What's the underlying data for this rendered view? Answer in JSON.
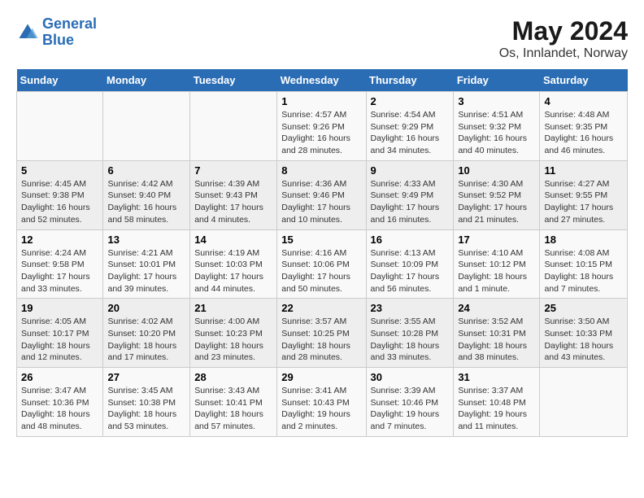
{
  "header": {
    "logo_line1": "General",
    "logo_line2": "Blue",
    "title": "May 2024",
    "subtitle": "Os, Innlandet, Norway"
  },
  "weekdays": [
    "Sunday",
    "Monday",
    "Tuesday",
    "Wednesday",
    "Thursday",
    "Friday",
    "Saturday"
  ],
  "weeks": [
    [
      {
        "day": "",
        "info": ""
      },
      {
        "day": "",
        "info": ""
      },
      {
        "day": "",
        "info": ""
      },
      {
        "day": "1",
        "info": "Sunrise: 4:57 AM\nSunset: 9:26 PM\nDaylight: 16 hours\nand 28 minutes."
      },
      {
        "day": "2",
        "info": "Sunrise: 4:54 AM\nSunset: 9:29 PM\nDaylight: 16 hours\nand 34 minutes."
      },
      {
        "day": "3",
        "info": "Sunrise: 4:51 AM\nSunset: 9:32 PM\nDaylight: 16 hours\nand 40 minutes."
      },
      {
        "day": "4",
        "info": "Sunrise: 4:48 AM\nSunset: 9:35 PM\nDaylight: 16 hours\nand 46 minutes."
      }
    ],
    [
      {
        "day": "5",
        "info": "Sunrise: 4:45 AM\nSunset: 9:38 PM\nDaylight: 16 hours\nand 52 minutes."
      },
      {
        "day": "6",
        "info": "Sunrise: 4:42 AM\nSunset: 9:40 PM\nDaylight: 16 hours\nand 58 minutes."
      },
      {
        "day": "7",
        "info": "Sunrise: 4:39 AM\nSunset: 9:43 PM\nDaylight: 17 hours\nand 4 minutes."
      },
      {
        "day": "8",
        "info": "Sunrise: 4:36 AM\nSunset: 9:46 PM\nDaylight: 17 hours\nand 10 minutes."
      },
      {
        "day": "9",
        "info": "Sunrise: 4:33 AM\nSunset: 9:49 PM\nDaylight: 17 hours\nand 16 minutes."
      },
      {
        "day": "10",
        "info": "Sunrise: 4:30 AM\nSunset: 9:52 PM\nDaylight: 17 hours\nand 21 minutes."
      },
      {
        "day": "11",
        "info": "Sunrise: 4:27 AM\nSunset: 9:55 PM\nDaylight: 17 hours\nand 27 minutes."
      }
    ],
    [
      {
        "day": "12",
        "info": "Sunrise: 4:24 AM\nSunset: 9:58 PM\nDaylight: 17 hours\nand 33 minutes."
      },
      {
        "day": "13",
        "info": "Sunrise: 4:21 AM\nSunset: 10:01 PM\nDaylight: 17 hours\nand 39 minutes."
      },
      {
        "day": "14",
        "info": "Sunrise: 4:19 AM\nSunset: 10:03 PM\nDaylight: 17 hours\nand 44 minutes."
      },
      {
        "day": "15",
        "info": "Sunrise: 4:16 AM\nSunset: 10:06 PM\nDaylight: 17 hours\nand 50 minutes."
      },
      {
        "day": "16",
        "info": "Sunrise: 4:13 AM\nSunset: 10:09 PM\nDaylight: 17 hours\nand 56 minutes."
      },
      {
        "day": "17",
        "info": "Sunrise: 4:10 AM\nSunset: 10:12 PM\nDaylight: 18 hours\nand 1 minute."
      },
      {
        "day": "18",
        "info": "Sunrise: 4:08 AM\nSunset: 10:15 PM\nDaylight: 18 hours\nand 7 minutes."
      }
    ],
    [
      {
        "day": "19",
        "info": "Sunrise: 4:05 AM\nSunset: 10:17 PM\nDaylight: 18 hours\nand 12 minutes."
      },
      {
        "day": "20",
        "info": "Sunrise: 4:02 AM\nSunset: 10:20 PM\nDaylight: 18 hours\nand 17 minutes."
      },
      {
        "day": "21",
        "info": "Sunrise: 4:00 AM\nSunset: 10:23 PM\nDaylight: 18 hours\nand 23 minutes."
      },
      {
        "day": "22",
        "info": "Sunrise: 3:57 AM\nSunset: 10:25 PM\nDaylight: 18 hours\nand 28 minutes."
      },
      {
        "day": "23",
        "info": "Sunrise: 3:55 AM\nSunset: 10:28 PM\nDaylight: 18 hours\nand 33 minutes."
      },
      {
        "day": "24",
        "info": "Sunrise: 3:52 AM\nSunset: 10:31 PM\nDaylight: 18 hours\nand 38 minutes."
      },
      {
        "day": "25",
        "info": "Sunrise: 3:50 AM\nSunset: 10:33 PM\nDaylight: 18 hours\nand 43 minutes."
      }
    ],
    [
      {
        "day": "26",
        "info": "Sunrise: 3:47 AM\nSunset: 10:36 PM\nDaylight: 18 hours\nand 48 minutes."
      },
      {
        "day": "27",
        "info": "Sunrise: 3:45 AM\nSunset: 10:38 PM\nDaylight: 18 hours\nand 53 minutes."
      },
      {
        "day": "28",
        "info": "Sunrise: 3:43 AM\nSunset: 10:41 PM\nDaylight: 18 hours\nand 57 minutes."
      },
      {
        "day": "29",
        "info": "Sunrise: 3:41 AM\nSunset: 10:43 PM\nDaylight: 19 hours\nand 2 minutes."
      },
      {
        "day": "30",
        "info": "Sunrise: 3:39 AM\nSunset: 10:46 PM\nDaylight: 19 hours\nand 7 minutes."
      },
      {
        "day": "31",
        "info": "Sunrise: 3:37 AM\nSunset: 10:48 PM\nDaylight: 19 hours\nand 11 minutes."
      },
      {
        "day": "",
        "info": ""
      }
    ]
  ]
}
